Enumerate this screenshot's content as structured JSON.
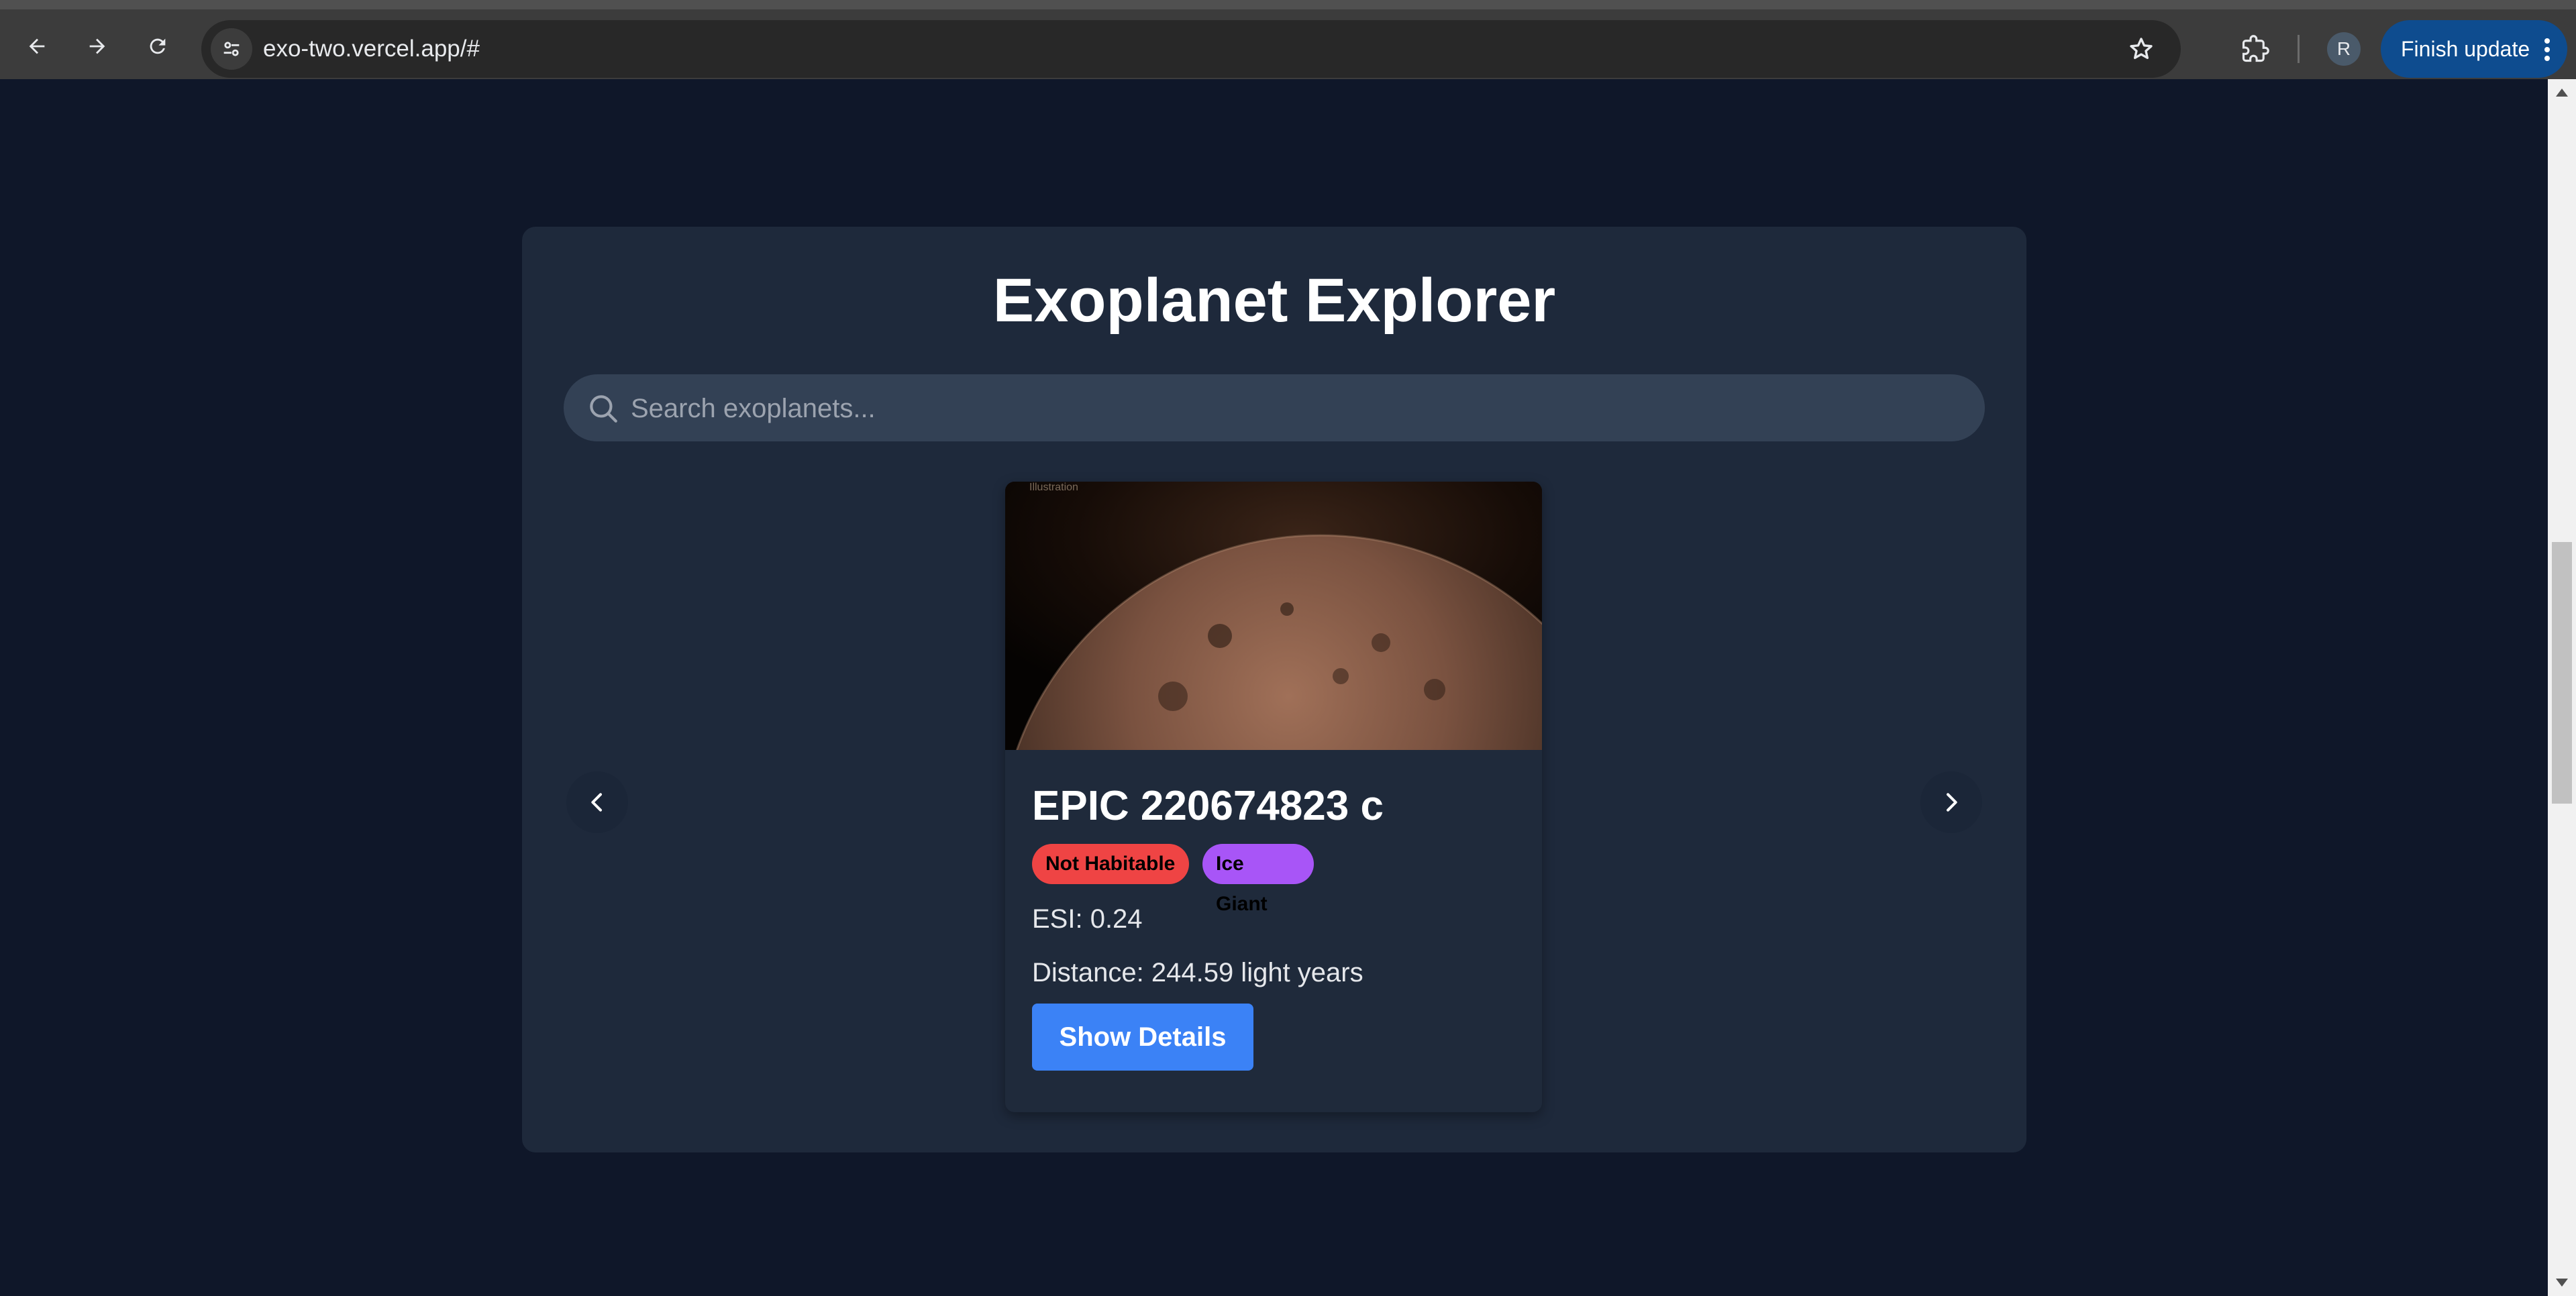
{
  "browser": {
    "url": "exo-two.vercel.app/#",
    "profile_initial": "R",
    "update_label": "Finish update"
  },
  "page": {
    "title": "Exoplanet Explorer",
    "search": {
      "placeholder": "Search exoplanets...",
      "value": ""
    },
    "card": {
      "image_label": "Illustration",
      "name": "EPIC 220674823 c",
      "badges": [
        {
          "label": "Not Habitable",
          "color": "#ef4444"
        },
        {
          "label": "Ice Giant",
          "color": "#a855f7"
        }
      ],
      "esi": "ESI: 0.24",
      "distance": "Distance: 244.59 light years",
      "details_label": "Show Details"
    },
    "icons": {
      "prev": "chevron-left-icon",
      "next": "chevron-right-icon",
      "search": "search-icon"
    }
  },
  "colors": {
    "background": "#0f1729",
    "panel": "#1e293b",
    "search": "#334155",
    "accent": "#3b82f6"
  }
}
